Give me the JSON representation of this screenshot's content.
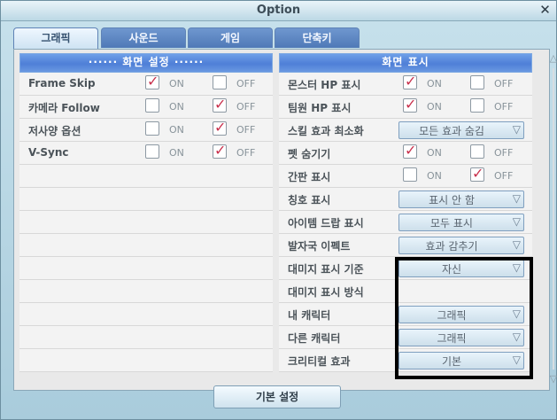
{
  "window": {
    "title": "Option",
    "close_label": "✕"
  },
  "tabs": [
    {
      "label": "그래픽",
      "active": true
    },
    {
      "label": "사운드"
    },
    {
      "label": "게임"
    },
    {
      "label": "단축키"
    }
  ],
  "left_header": "······ 화면 설정 ······",
  "right_header": "화면 표시",
  "left_rows": [
    {
      "label": "Frame Skip",
      "on": true,
      "off": false,
      "on_label": "ON",
      "off_label": "OFF"
    },
    {
      "label": "카메라 Follow",
      "on": false,
      "off": true,
      "on_label": "ON",
      "off_label": "OFF"
    },
    {
      "label": "저사양 옵션",
      "on": false,
      "off": true,
      "on_label": "ON",
      "off_label": "OFF"
    },
    {
      "label": "V-Sync",
      "on": false,
      "off": true,
      "on_label": "ON",
      "off_label": "OFF"
    }
  ],
  "right_rows": [
    {
      "label": "몬스터 HP 표시",
      "on": true,
      "off": false,
      "on_label": "ON",
      "off_label": "OFF"
    },
    {
      "label": "팀원 HP 표시",
      "on": true,
      "off": false,
      "on_label": "ON",
      "off_label": "OFF"
    },
    {
      "label": "스킬 효과 최소화",
      "dropdown": "모든 효과 숨김"
    },
    {
      "label": "펫 숨기기",
      "on": true,
      "off": false,
      "on_label": "ON",
      "off_label": "OFF"
    },
    {
      "label": "간판 표시",
      "on": false,
      "off": true,
      "on_label": "ON",
      "off_label": "OFF"
    },
    {
      "label": "칭호 표시",
      "dropdown": "표시 안 함"
    },
    {
      "label": "아이템 드랍 표시",
      "dropdown": "모두 표시"
    },
    {
      "label": "발자국 이펙트",
      "dropdown": "효과 감추기"
    },
    {
      "label": "대미지 표시 기준",
      "dropdown": "자신"
    },
    {
      "label": "대미지 표시 방식"
    },
    {
      "label": "내 캐릭터",
      "dropdown": "그래픽"
    },
    {
      "label": "다른 캐릭터",
      "dropdown": "그래픽"
    },
    {
      "label": "크리티컬 효과",
      "dropdown": "기본"
    }
  ],
  "default_button": "기본 설정",
  "icons": {
    "checkbox_checked": "checkmark-icon",
    "dropdown_arrow": "chevron-down-icon",
    "scroll_up": "scroll-up-icon",
    "scroll_down": "scroll-down-icon"
  }
}
